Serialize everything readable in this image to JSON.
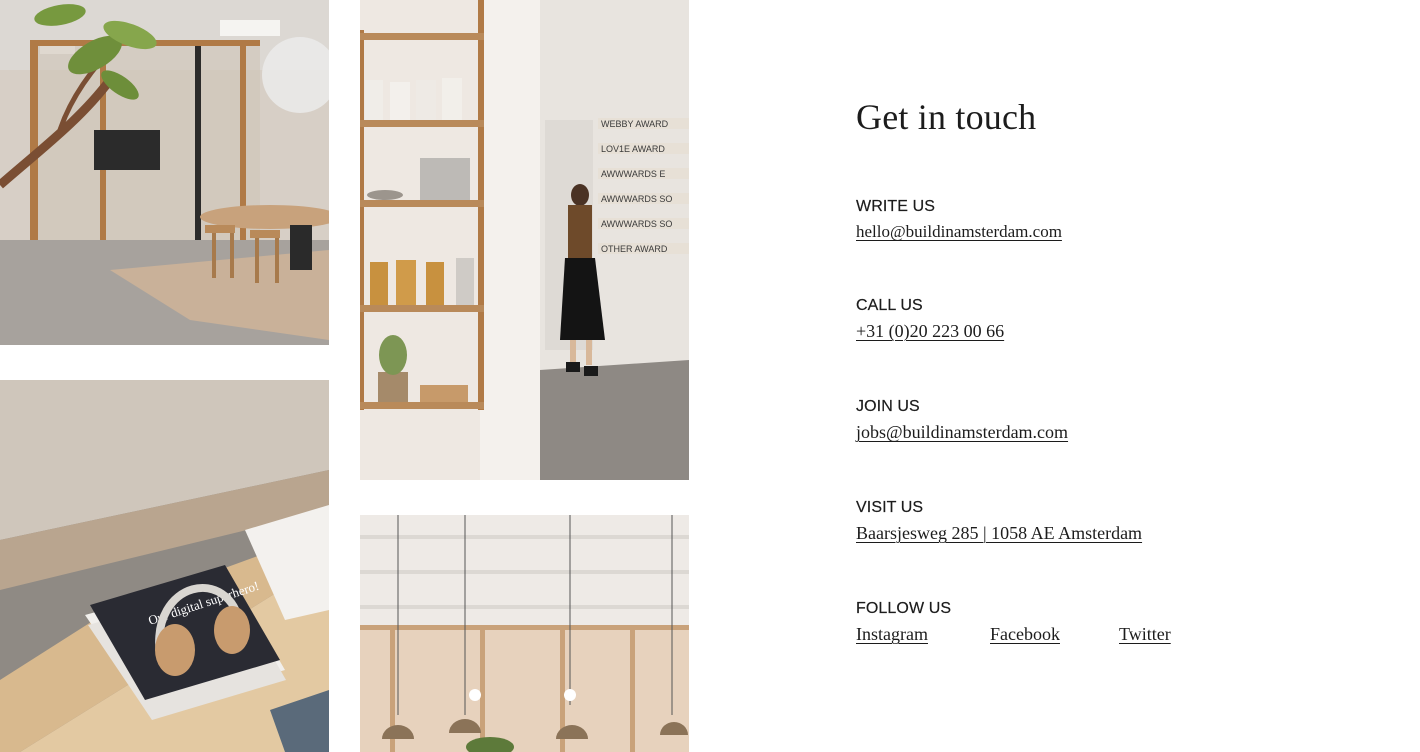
{
  "photos": {
    "office": {
      "alt_name": "office-meeting-room-photo"
    },
    "coffee_table": {
      "alt_name": "coffee-table-headphones-photo"
    },
    "shelf": {
      "alt_name": "shelf-and-awards-wall-photo",
      "award_plaques": [
        "WEBBY AWARD",
        "LOV1E AWARD",
        "AWWWARDS E",
        "AWWWARDS SO",
        "AWWWARDS SO",
        "OTHER AWARD"
      ]
    },
    "lights": {
      "alt_name": "pendant-lights-photo"
    },
    "magazine_text": "Our digital superhero!"
  },
  "contact": {
    "title": "Get in touch",
    "write": {
      "label": "WRITE US",
      "value": "hello@buildinamsterdam.com"
    },
    "call": {
      "label": "CALL US",
      "value": "+31 (0)20 223 00 66"
    },
    "join": {
      "label": "JOIN US",
      "value": "jobs@buildinamsterdam.com"
    },
    "visit": {
      "label": "VISIT US",
      "value": "Baarsjesweg 285 | 1058 AE Amsterdam"
    },
    "follow": {
      "label": "FOLLOW US",
      "links": [
        "Instagram",
        "Facebook",
        "Twitter"
      ]
    }
  },
  "colors": {
    "text": "#1c1c1c",
    "background": "#ffffff",
    "wood": "#b98a5a",
    "wall": "#ece6e0",
    "floor": "#9a9590"
  }
}
